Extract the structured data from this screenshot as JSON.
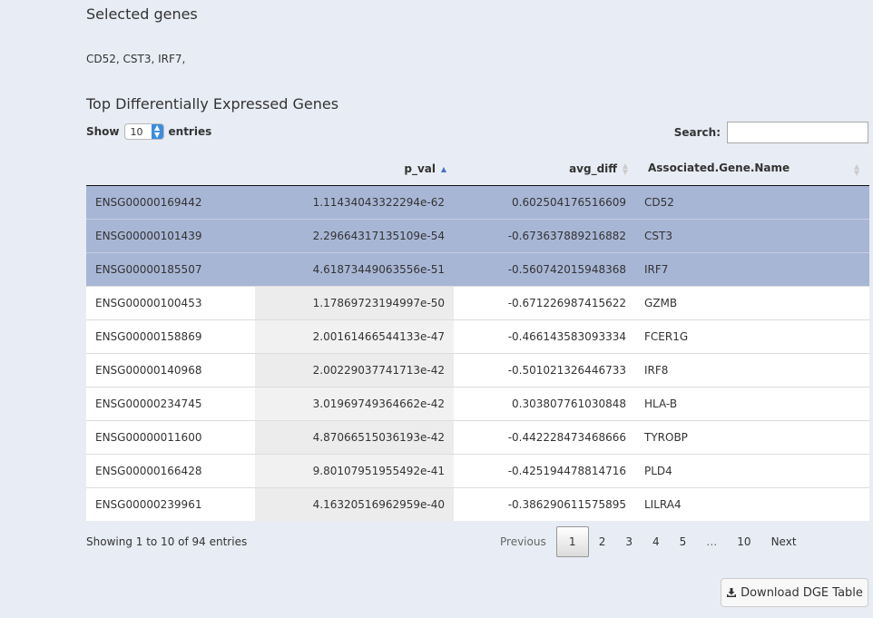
{
  "selected": {
    "title": "Selected genes",
    "list": "CD52, CST3, IRF7,"
  },
  "table_title": "Top Differentially Expressed Genes",
  "length": {
    "show": "Show",
    "value": "10",
    "entries": "entries"
  },
  "search": {
    "label": "Search:",
    "value": ""
  },
  "columns": [
    "",
    "p_val",
    "avg_diff",
    "Associated.Gene.Name"
  ],
  "sort": {
    "column": "p_val",
    "direction": "ascending"
  },
  "rows": [
    {
      "id": "ENSG00000169442",
      "p_val": "1.11434043322294e-62",
      "avg_diff": "0.602504176516609",
      "gene": "CD52",
      "selected": true
    },
    {
      "id": "ENSG00000101439",
      "p_val": "2.29664317135109e-54",
      "avg_diff": "-0.673637889216882",
      "gene": "CST3",
      "selected": true
    },
    {
      "id": "ENSG00000185507",
      "p_val": "4.61873449063556e-51",
      "avg_diff": "-0.560742015948368",
      "gene": "IRF7",
      "selected": true
    },
    {
      "id": "ENSG00000100453",
      "p_val": "1.17869723194997e-50",
      "avg_diff": "-0.671226987415622",
      "gene": "GZMB",
      "selected": false
    },
    {
      "id": "ENSG00000158869",
      "p_val": "2.00161466544133e-47",
      "avg_diff": "-0.466143583093334",
      "gene": "FCER1G",
      "selected": false
    },
    {
      "id": "ENSG00000140968",
      "p_val": "2.00229037741713e-42",
      "avg_diff": "-0.501021326446733",
      "gene": "IRF8",
      "selected": false
    },
    {
      "id": "ENSG00000234745",
      "p_val": "3.01969749364662e-42",
      "avg_diff": "0.303807761030848",
      "gene": "HLA-B",
      "selected": false
    },
    {
      "id": "ENSG00000011600",
      "p_val": "4.87066515036193e-42",
      "avg_diff": "-0.442228473468666",
      "gene": "TYROBP",
      "selected": false
    },
    {
      "id": "ENSG00000166428",
      "p_val": "9.80107951955492e-41",
      "avg_diff": "-0.425194478814716",
      "gene": "PLD4",
      "selected": false
    },
    {
      "id": "ENSG00000239961",
      "p_val": "4.16320516962959e-40",
      "avg_diff": "-0.386290611575895",
      "gene": "LILRA4",
      "selected": false
    }
  ],
  "info": "Showing 1 to 10 of 94 entries",
  "pagination": {
    "previous": "Previous",
    "pages": [
      "1",
      "2",
      "3",
      "4",
      "5",
      "…",
      "10"
    ],
    "current": "1",
    "next": "Next"
  },
  "download": {
    "label": "Download DGE Table",
    "icon": "download-icon"
  },
  "colors": {
    "selected_row": "#a8b6d6",
    "background": "#e8ecf4",
    "sort_active": "#4b74c0"
  }
}
